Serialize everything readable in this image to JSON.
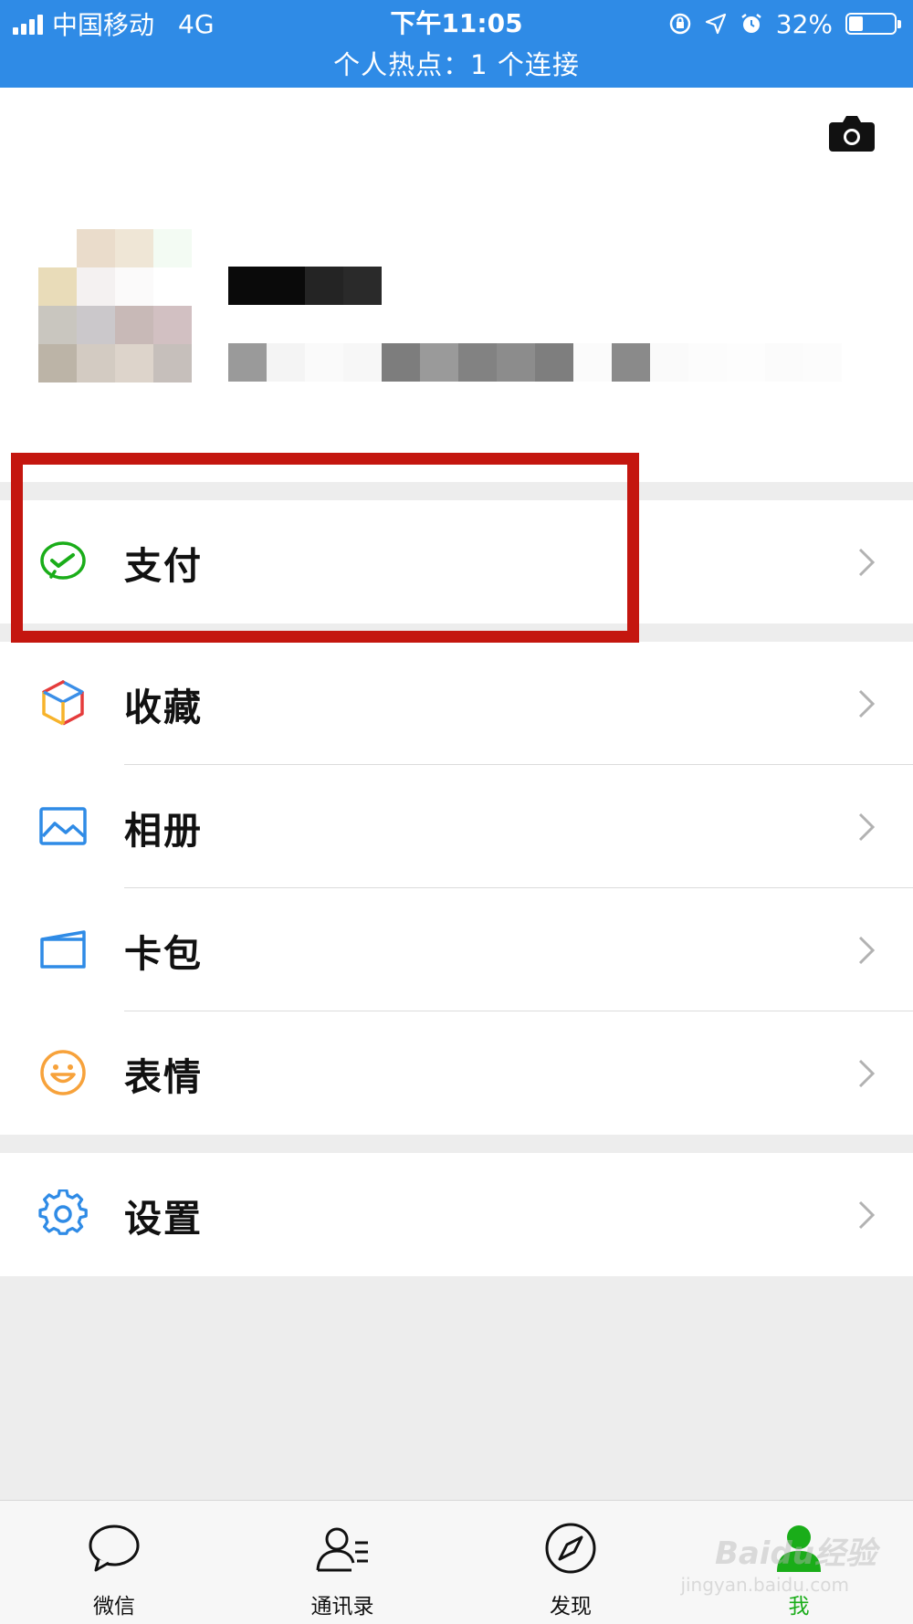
{
  "status_bar": {
    "carrier": "中国移动",
    "network": "4G",
    "time": "下午11:05",
    "battery_text": "32%",
    "battery_level": 0.32,
    "hotspot": "个人热点：1 个连接"
  },
  "profile": {
    "camera_icon": "camera-icon"
  },
  "menu": {
    "pay": "支付",
    "favorites": "收藏",
    "album": "相册",
    "cards": "卡包",
    "stickers": "表情",
    "settings": "设置"
  },
  "tabs": {
    "chats": "微信",
    "contacts": "通讯录",
    "discover": "发现",
    "me": "我"
  },
  "watermark": {
    "brand": "Baidu经验",
    "url": "jingyan.baidu.com"
  },
  "colors": {
    "status_bar": "#2f8be6",
    "accent_green": "#1aad19",
    "highlight_red": "#c4160f"
  }
}
